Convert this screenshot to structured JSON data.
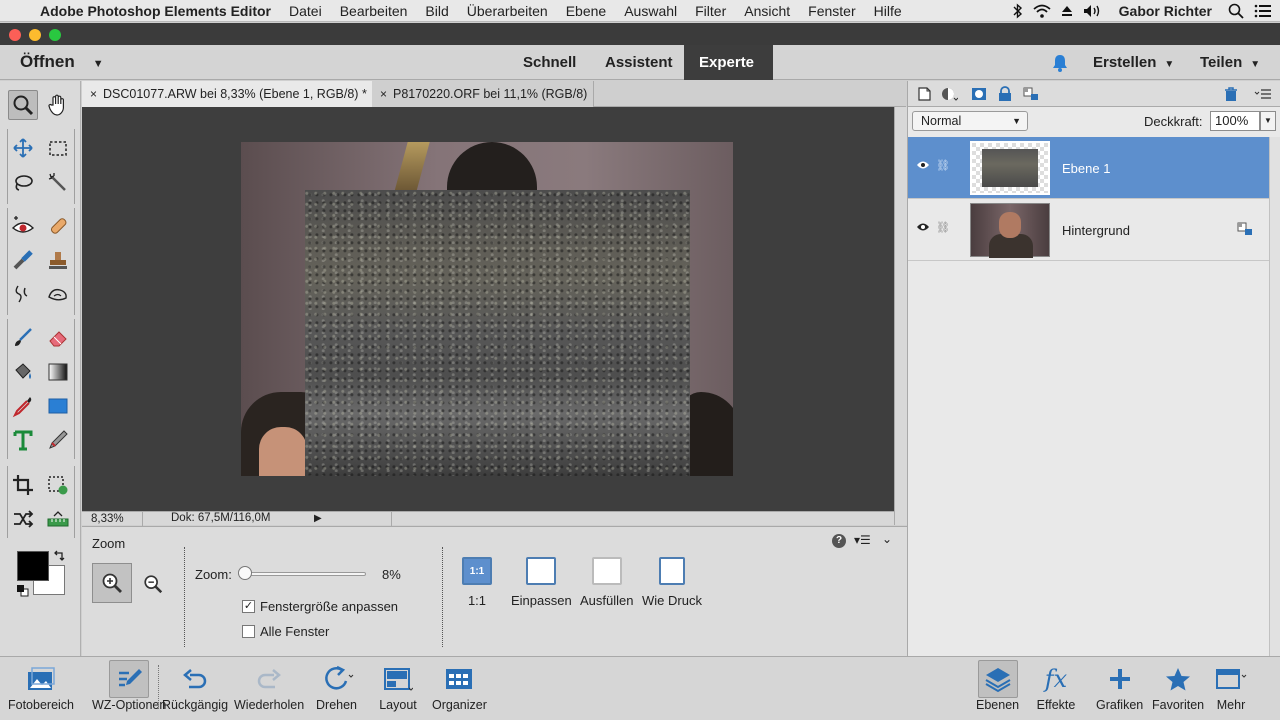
{
  "menubar": {
    "app_name": "Adobe Photoshop Elements Editor",
    "menus": [
      "Datei",
      "Bearbeiten",
      "Bild",
      "Überarbeiten",
      "Ebene",
      "Auswahl",
      "Filter",
      "Ansicht",
      "Fenster",
      "Hilfe"
    ],
    "user": "Gabor Richter",
    "status_icons": [
      "bluetooth-icon",
      "wifi-icon",
      "eject-icon",
      "volume-icon",
      "spotlight-icon",
      "notification-list-icon"
    ]
  },
  "topbar": {
    "open_label": "Öffnen",
    "modes": {
      "quick": "Schnell",
      "assistant": "Assistent",
      "expert": "Experte"
    },
    "active_mode": "expert",
    "create_label": "Erstellen",
    "share_label": "Teilen",
    "accent_color": "#2a7fd4"
  },
  "documents": {
    "tab1": "DSC01077.ARW bei 8,33% (Ebene 1, RGB/8) *",
    "tab2": "P8170220.ORF bei 11,1% (RGB/8)",
    "close_glyph": "×"
  },
  "statusbar": {
    "zoom": "8,33%",
    "doc_info": "Dok: 67,5M/116,0M"
  },
  "tool_options": {
    "title": "Zoom",
    "zoom_label": "Zoom:",
    "zoom_value": "8%",
    "zoom_fraction": 0.0,
    "fit_window_label": "Fenstergröße anpassen",
    "fit_window_checked": true,
    "all_windows_label": "Alle Fenster",
    "all_windows_checked": false,
    "buttons": {
      "actual": "1:1",
      "fit": "Einpassen",
      "fill": "Ausfüllen",
      "print": "Wie Druck"
    },
    "actual_icon_text": "1:1"
  },
  "layers": {
    "blend_mode": "Normal",
    "opacity_label": "Deckkraft:",
    "opacity_value": "100%",
    "items": [
      {
        "name": "Ebene 1",
        "selected": true
      },
      {
        "name": "Hintergrund",
        "selected": false
      }
    ],
    "selected_color": "#5d8fcd"
  },
  "taskbar": {
    "photo_bin": "Fotobereich",
    "tool_options": "WZ-Optionen",
    "undo": "Rückgängig",
    "redo": "Wiederholen",
    "rotate": "Drehen",
    "layout": "Layout",
    "organizer": "Organizer",
    "layers": "Ebenen",
    "effects": "Effekte",
    "graphics": "Grafiken",
    "favorites": "Favoriten",
    "more": "Mehr"
  }
}
